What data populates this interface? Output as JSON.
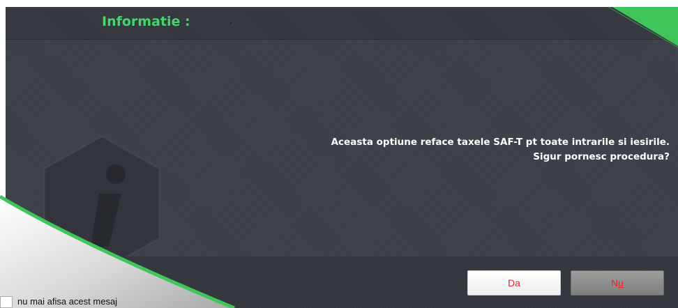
{
  "dialog": {
    "title": "Informatie :",
    "message_line1": "Aceasta optiune reface taxele SAF-T pt toate intrarile si iesirile.",
    "message_line2": "Sigur pornesc procedura?",
    "watermark_icon": "info-icon"
  },
  "buttons": {
    "yes_label": "Da",
    "no_prefix": "N",
    "no_accel": "u"
  },
  "checkbox": {
    "label": "nu mai afisa acest mesaj",
    "checked": false
  },
  "colors": {
    "title": "#45d66b",
    "accent_green": "#3fc55a",
    "button_text": "#e4282b",
    "dialog_bg": "#3d4149"
  }
}
